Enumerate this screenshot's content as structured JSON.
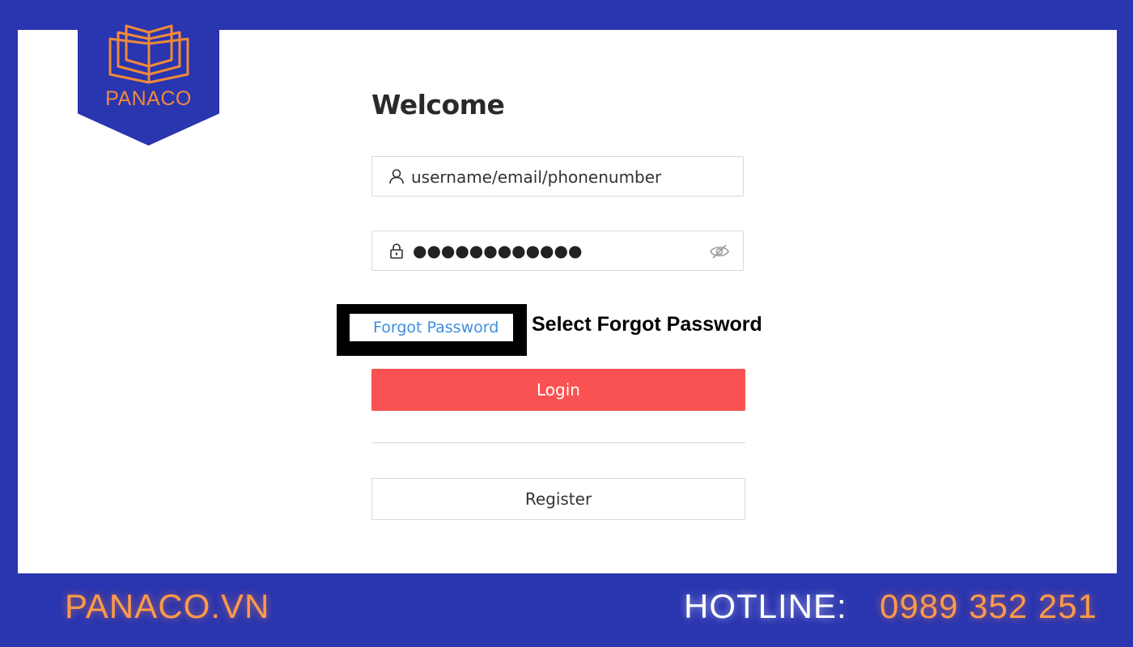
{
  "brand": {
    "logo_text": "PANACO",
    "accent_color": "#f08a38",
    "background_color": "#2a35b0"
  },
  "login_form": {
    "title": "Welcome",
    "username_field": {
      "placeholder": "username/email/phonenumber",
      "icon": "user-icon"
    },
    "password_field": {
      "value_masked": "●●●●●●●●●●●●",
      "icon": "lock-icon",
      "toggle_icon": "eye-slash-icon"
    },
    "forgot_password_label": "Forgot Password",
    "annotation": "Select Forgot Password",
    "login_label": "Login",
    "login_color": "#fa5252",
    "register_label": "Register"
  },
  "footer": {
    "website": "PANACO.VN",
    "hotline_label": "HOTLINE:",
    "hotline_number": "0989 352 251"
  }
}
